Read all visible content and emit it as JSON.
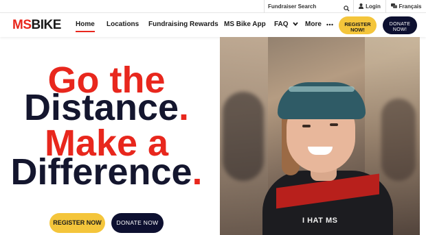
{
  "utility": {
    "search_placeholder": "Fundraiser Search",
    "login_label": "Login",
    "language_label": "Français"
  },
  "nav": {
    "logo_ms": "MS",
    "logo_bike": "BIKE",
    "items": [
      {
        "label": "Home",
        "active": true
      },
      {
        "label": "Locations"
      },
      {
        "label": "Fundraising Rewards"
      },
      {
        "label": "MS Bike App"
      },
      {
        "label": "FAQ"
      },
      {
        "label": "More"
      }
    ],
    "register_line1": "REGISTER",
    "register_line2": "NOW!",
    "donate_line1": "DONATE",
    "donate_line2": "NOW!"
  },
  "hero": {
    "line1": "Go the",
    "line2": "Distance",
    "line3": "Make a",
    "line4": "Difference",
    "dot": ".",
    "register_button": "REGISTER NOW",
    "donate_button": "DONATE NOW",
    "jersey_text": "I HAT MS"
  },
  "colors": {
    "brand_red": "#e8271d",
    "navy": "#14162e",
    "yellow": "#f4c53b"
  }
}
